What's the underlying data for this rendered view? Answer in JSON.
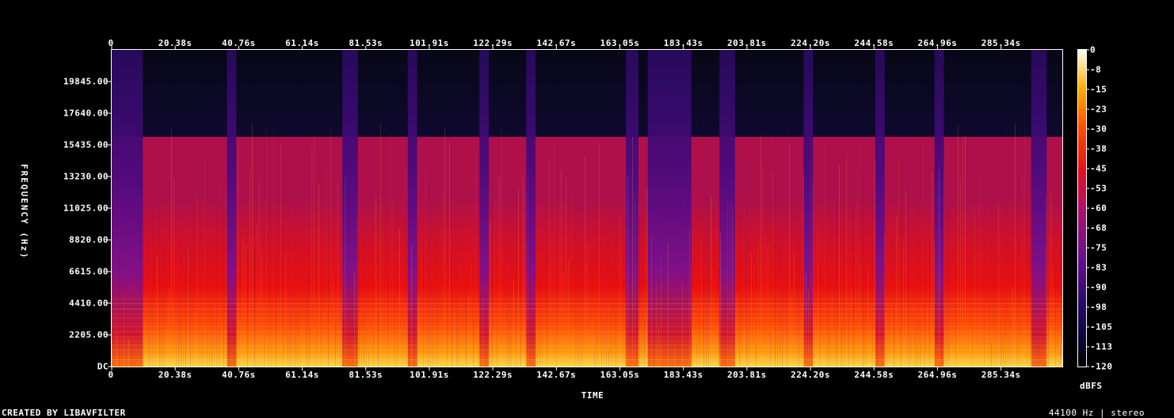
{
  "chart_data": {
    "type": "heatmap",
    "title": "",
    "xlabel": "TIME",
    "ylabel": "FREQUENCY (Hz)",
    "x_ticks": [
      "0",
      "20.38s",
      "40.76s",
      "61.14s",
      "81.53s",
      "101.91s",
      "122.29s",
      "142.67s",
      "163.05s",
      "183.43s",
      "203.81s",
      "224.20s",
      "244.58s",
      "264.96s",
      "285.34s"
    ],
    "x_tick_values": [
      0,
      20.38,
      40.76,
      61.14,
      81.53,
      101.91,
      122.29,
      142.67,
      163.05,
      183.43,
      203.81,
      224.2,
      244.58,
      264.96,
      285.34
    ],
    "x_range": [
      0,
      305
    ],
    "y_ticks": [
      "DC",
      "2205.00",
      "4410.00",
      "6615.00",
      "8820.00",
      "11025.00",
      "13230.00",
      "15435.00",
      "17640.00",
      "19845.00"
    ],
    "y_tick_values": [
      0,
      2205,
      4410,
      6615,
      8820,
      11025,
      13230,
      15435,
      17640,
      19845
    ],
    "y_range": [
      0,
      22050
    ],
    "colorbar": {
      "label": "dBFS",
      "ticks": [
        "0",
        "-8",
        "-15",
        "-23",
        "-30",
        "-38",
        "-45",
        "-53",
        "-60",
        "-68",
        "-75",
        "-83",
        "-90",
        "-98",
        "-105",
        "-113",
        "-120"
      ],
      "range": [
        -120,
        0
      ]
    },
    "lowpass_cutoff_hz": 16000,
    "quiet_segments_s": [
      [
        0,
        10
      ],
      [
        37,
        40
      ],
      [
        74,
        79
      ],
      [
        95,
        98
      ],
      [
        118,
        121
      ],
      [
        133,
        136
      ],
      [
        165,
        169
      ],
      [
        172,
        186
      ],
      [
        195,
        200
      ],
      [
        222,
        225
      ],
      [
        245,
        248
      ],
      [
        264,
        267
      ],
      [
        295,
        300
      ]
    ]
  },
  "footer": {
    "left": "CREATED BY LIBAVFILTER",
    "right": "44100 Hz | stereo"
  },
  "colors": {
    "background": "#000000",
    "text": "#ffffff",
    "border": "#ffffff"
  }
}
